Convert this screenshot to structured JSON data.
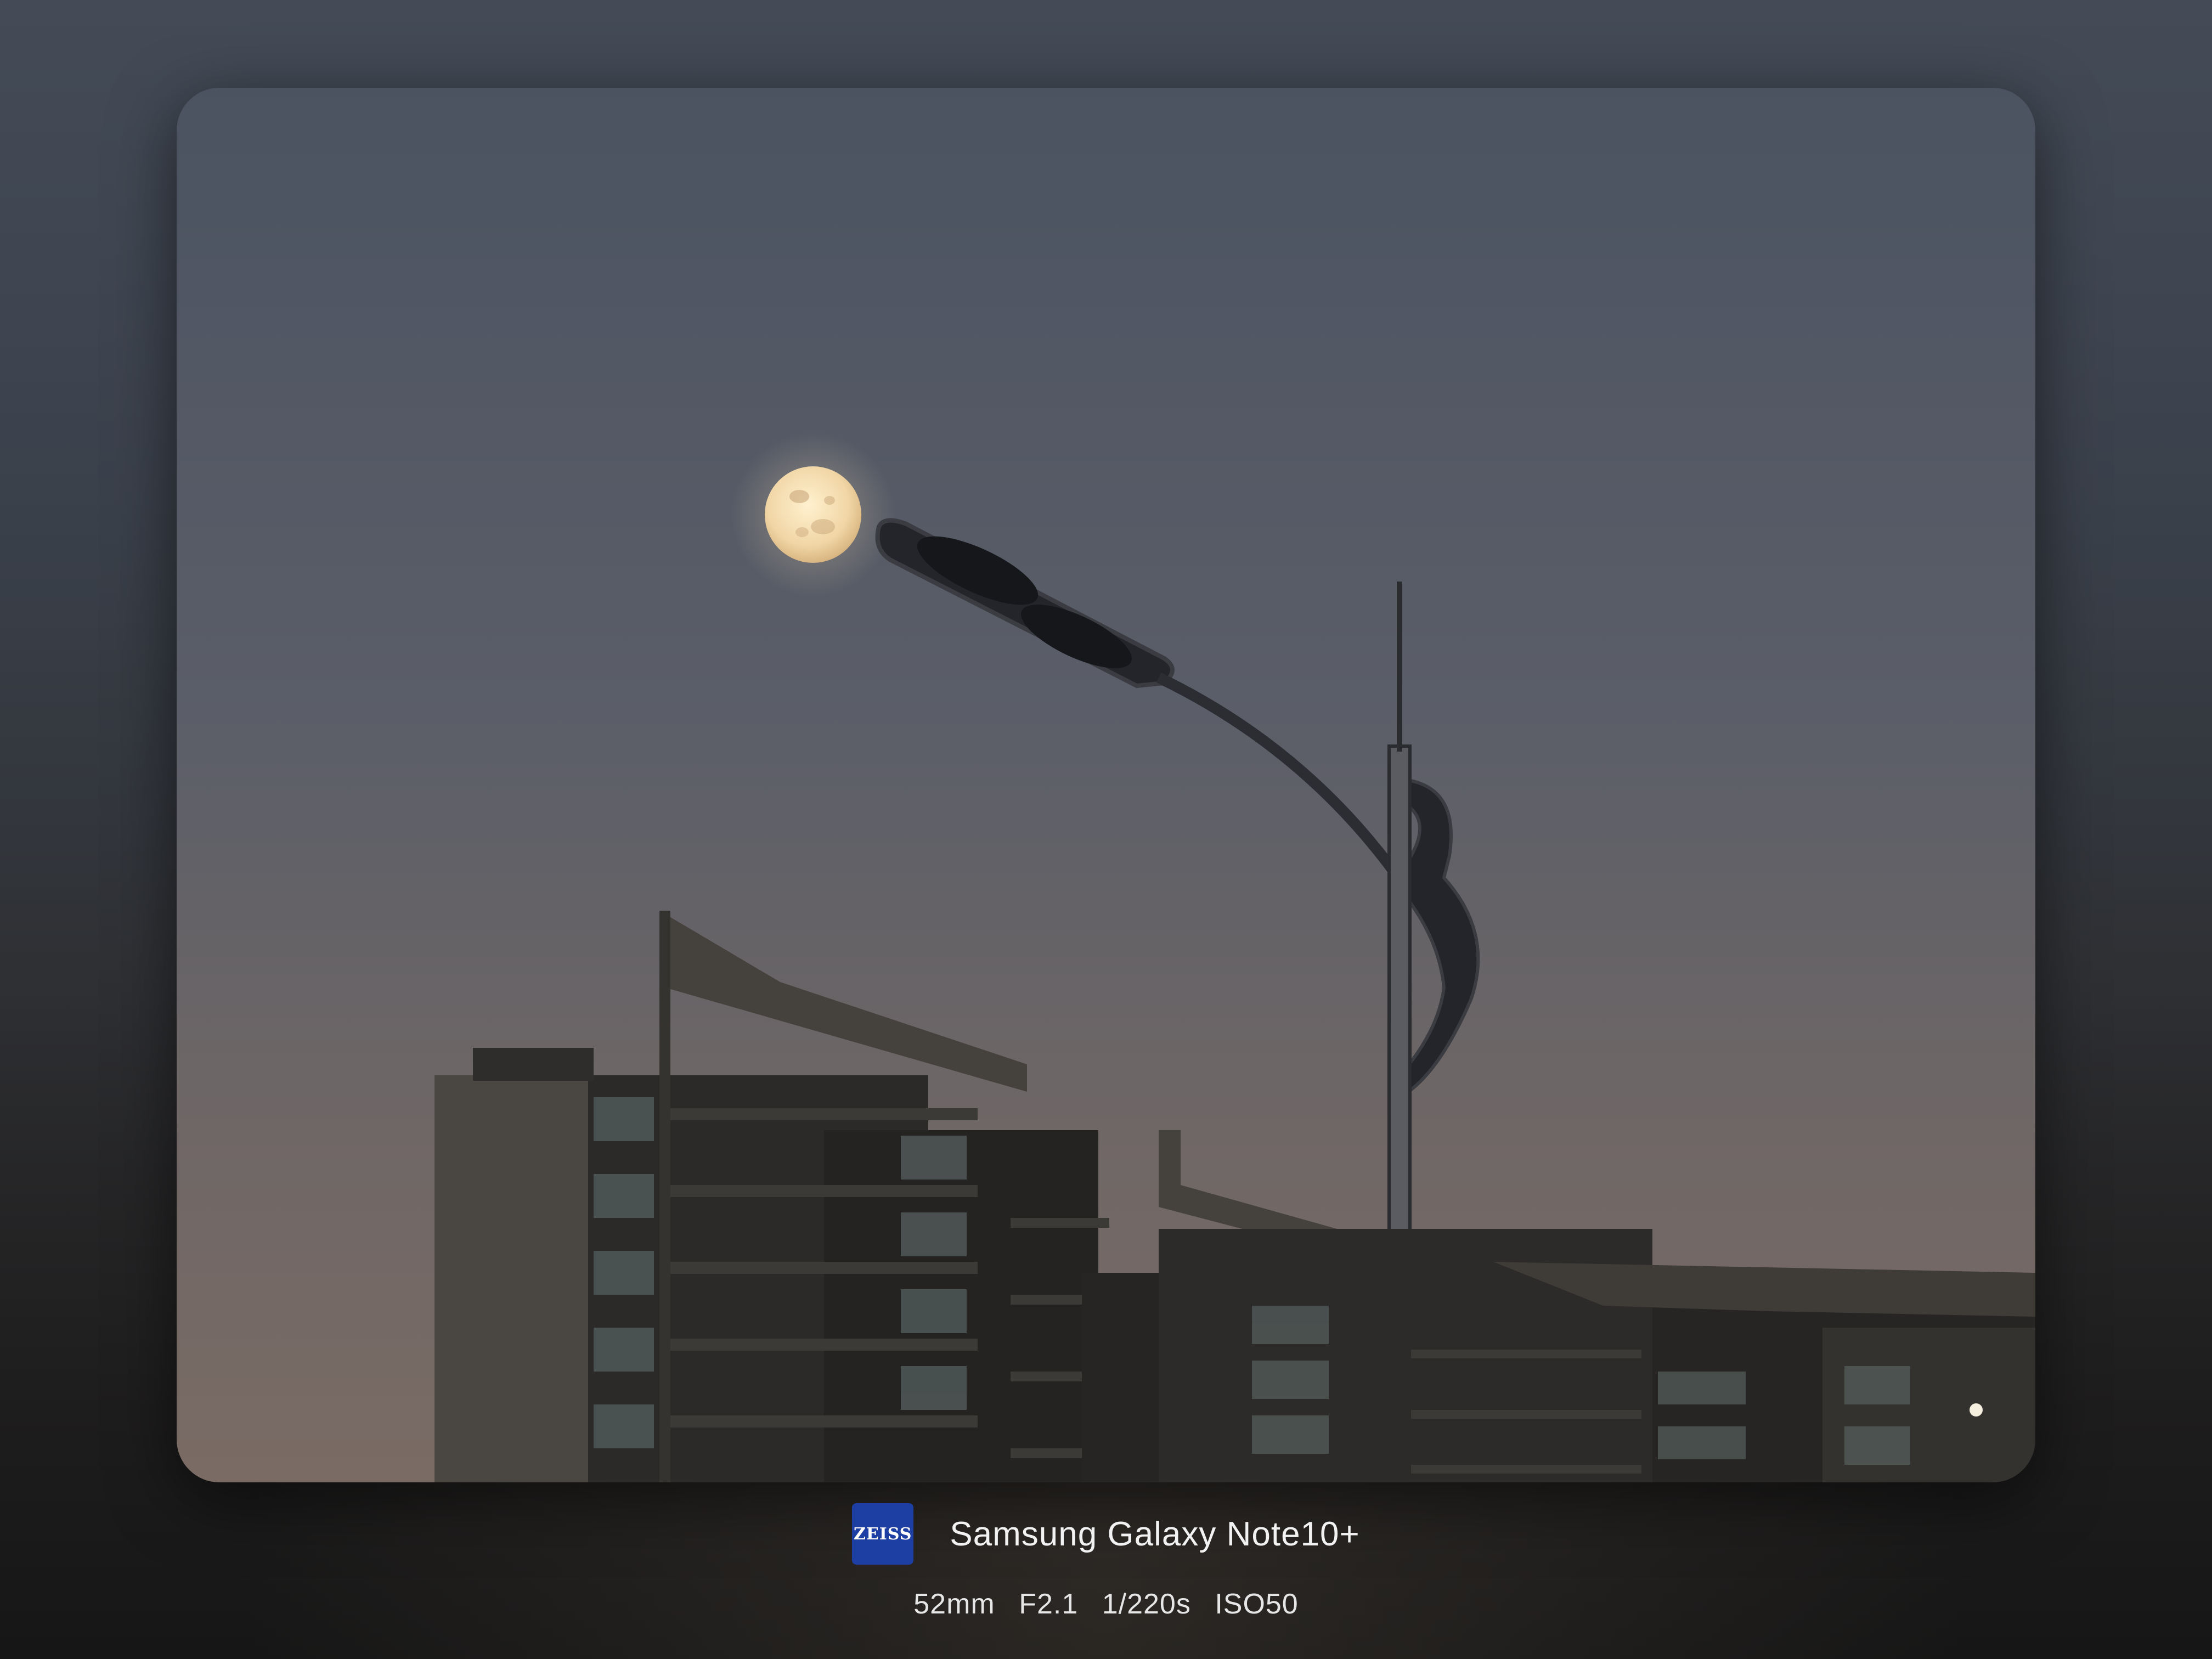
{
  "photo": {
    "alt_subjects": [
      "moon",
      "street-lamp",
      "apartment-buildings",
      "dusk-sky"
    ]
  },
  "caption": {
    "logo_text": "ZEISS",
    "device": "Samsung Galaxy Note10+",
    "exif": {
      "focal_length": "52mm",
      "aperture": "F2.1",
      "shutter": "1/220s",
      "iso": "ISO50"
    }
  },
  "colors": {
    "sky_top": "#4b5361",
    "sky_bottom": "#7a6b64",
    "logo_blue": "#1d3fa3"
  }
}
